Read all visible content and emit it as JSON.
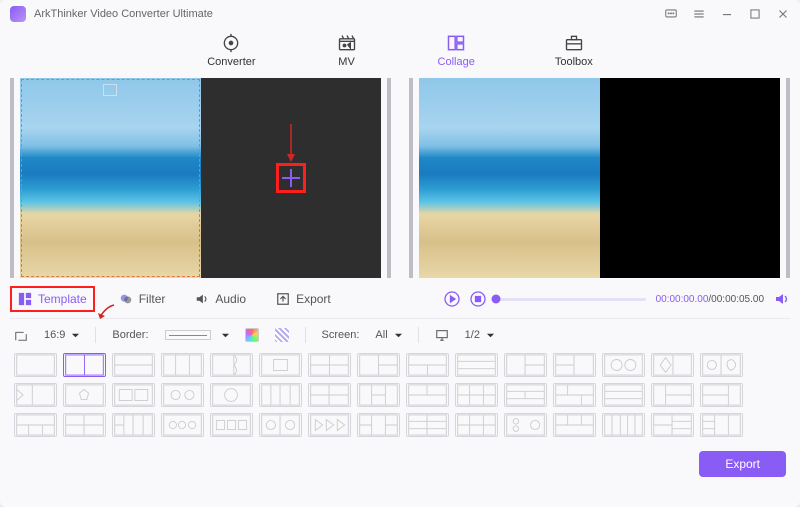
{
  "app": {
    "title": "ArkThinker Video Converter Ultimate"
  },
  "nav": {
    "converter": "Converter",
    "mv": "MV",
    "collage": "Collage",
    "toolbox": "Toolbox"
  },
  "tooltabs": {
    "template": "Template",
    "filter": "Filter",
    "audio": "Audio",
    "export": "Export"
  },
  "playback": {
    "current": "00:00:00.00",
    "separator": "/",
    "total": "00:00:05.00"
  },
  "options": {
    "ratio": "16:9",
    "border_label": "Border:",
    "screen_label": "Screen:",
    "screen_value": "All",
    "split_value": "1/2"
  },
  "footer": {
    "export": "Export"
  }
}
